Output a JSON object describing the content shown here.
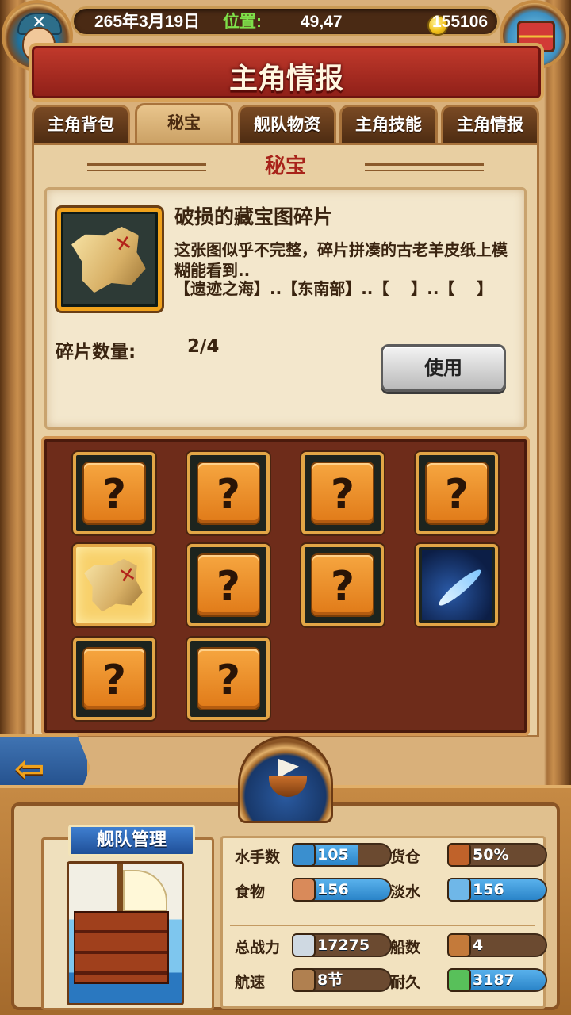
{
  "topbar": {
    "date": "265年3月19日",
    "position_label": "位置:",
    "position_value": "49,47",
    "gold": "155106",
    "coin_icon": "gold-coin-icon",
    "avatar_icon": "pirate-avatar-icon",
    "chest_icon": "treasure-chest-icon"
  },
  "title": "主角情报",
  "tabs": [
    {
      "label": "主角背包",
      "active": false
    },
    {
      "label": "秘宝",
      "active": true
    },
    {
      "label": "舰队物资",
      "active": false
    },
    {
      "label": "主角技能",
      "active": false
    },
    {
      "label": "主角情报",
      "active": false
    }
  ],
  "section": {
    "title": "秘宝"
  },
  "item": {
    "name": "破损的藏宝图碎片",
    "description": "这张图似乎不完整，碎片拼凑的古老羊皮纸上模糊能看到..",
    "location": "【遗迹之海】..【东南部】..【    】..【    】",
    "count_label": "碎片数量:",
    "count_value": "2/4",
    "use_button": "使用",
    "icon": "treasure-map-fragment-icon"
  },
  "grid": {
    "slots": [
      {
        "type": "unknown",
        "symbol": "?"
      },
      {
        "type": "unknown",
        "symbol": "?"
      },
      {
        "type": "unknown",
        "symbol": "?"
      },
      {
        "type": "unknown",
        "symbol": "?"
      },
      {
        "type": "map",
        "icon": "treasure-map-fragment-icon",
        "selected": true
      },
      {
        "type": "unknown",
        "symbol": "?"
      },
      {
        "type": "unknown",
        "symbol": "?"
      },
      {
        "type": "feather",
        "icon": "blue-feather-icon"
      },
      {
        "type": "unknown",
        "symbol": "?"
      },
      {
        "type": "unknown",
        "symbol": "?"
      }
    ]
  },
  "back_button": {
    "icon": "arrow-left-icon",
    "glyph": "⇦"
  },
  "fleet": {
    "label": "舰队管理",
    "helm_icon": "ship-helm-icon",
    "ship_icon": "galleon-ship-icon",
    "stats": [
      {
        "label": "水手数",
        "value": "105",
        "icon": "sailor-icon",
        "fill": 0.65
      },
      {
        "label": "货仓",
        "value": "50%",
        "icon": "cargo-crate-icon",
        "fill": 0.0
      },
      {
        "label": "食物",
        "value": "156",
        "icon": "meat-icon",
        "fill": 1.0
      },
      {
        "label": "淡水",
        "value": "156",
        "icon": "water-jug-icon",
        "fill": 1.0
      },
      {
        "label": "总战力",
        "value": "17275",
        "icon": "crossed-swords-icon",
        "fill": 0.0
      },
      {
        "label": "船数",
        "value": "4",
        "icon": "boat-icon",
        "fill": 0.0
      },
      {
        "label": "航速",
        "value": "8节",
        "icon": "sailboat-icon",
        "fill": 0.0
      },
      {
        "label": "耐久",
        "value": "3187",
        "icon": "repair-icon",
        "fill": 1.0
      }
    ]
  },
  "colors": {
    "accent_orange": "#f0a21c",
    "title_red": "#a8231a",
    "bar_blue": "#2a84c8"
  }
}
